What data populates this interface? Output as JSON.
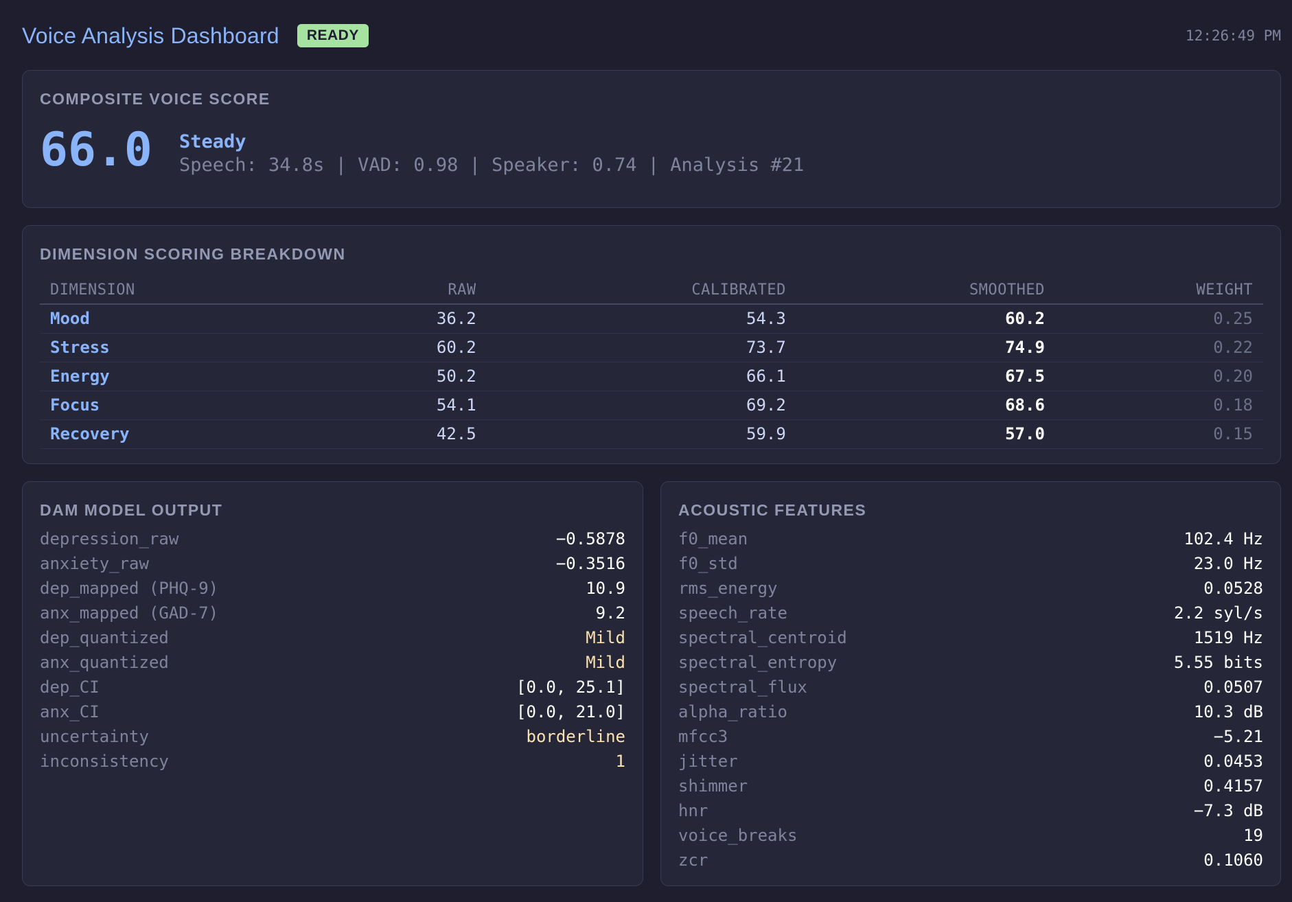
{
  "header": {
    "title": "Voice Analysis Dashboard",
    "status": "READY",
    "time": "12:26:49 PM"
  },
  "composite": {
    "title": "COMPOSITE VOICE SCORE",
    "score": "66.0",
    "state": "Steady",
    "meta": "Speech: 34.8s | VAD: 0.98 | Speaker: 0.74 | Analysis #21"
  },
  "dimensions": {
    "title": "DIMENSION SCORING BREAKDOWN",
    "columns": [
      "DIMENSION",
      "RAW",
      "CALIBRATED",
      "SMOOTHED",
      "WEIGHT"
    ],
    "rows": [
      {
        "name": "Mood",
        "raw": "36.2",
        "calibrated": "54.3",
        "smoothed": "60.2",
        "weight": "0.25"
      },
      {
        "name": "Stress",
        "raw": "60.2",
        "calibrated": "73.7",
        "smoothed": "74.9",
        "weight": "0.22"
      },
      {
        "name": "Energy",
        "raw": "50.2",
        "calibrated": "66.1",
        "smoothed": "67.5",
        "weight": "0.20"
      },
      {
        "name": "Focus",
        "raw": "54.1",
        "calibrated": "69.2",
        "smoothed": "68.6",
        "weight": "0.18"
      },
      {
        "name": "Recovery",
        "raw": "42.5",
        "calibrated": "59.9",
        "smoothed": "57.0",
        "weight": "0.15"
      }
    ]
  },
  "dam": {
    "title": "DAM MODEL OUTPUT",
    "rows": [
      {
        "key": "depression_raw",
        "value": "−0.5878"
      },
      {
        "key": "anxiety_raw",
        "value": "−0.3516"
      },
      {
        "key": "dep_mapped (PHQ-9)",
        "value": "10.9"
      },
      {
        "key": "anx_mapped (GAD-7)",
        "value": "9.2"
      },
      {
        "key": "dep_quantized",
        "value": "Mild",
        "highlight": "#f9e2af"
      },
      {
        "key": "anx_quantized",
        "value": "Mild",
        "highlight": "#f9e2af"
      },
      {
        "key": "dep_CI",
        "value": "[0.0, 25.1]"
      },
      {
        "key": "anx_CI",
        "value": "[0.0, 21.0]"
      },
      {
        "key": "uncertainty",
        "value": "borderline",
        "highlight": "#f9e2af"
      },
      {
        "key": "inconsistency",
        "value": "1",
        "highlight": "#f9e2af"
      }
    ]
  },
  "acoustic": {
    "title": "ACOUSTIC FEATURES",
    "rows": [
      {
        "key": "f0_mean",
        "value": "102.4 Hz"
      },
      {
        "key": "f0_std",
        "value": "23.0 Hz"
      },
      {
        "key": "rms_energy",
        "value": "0.0528"
      },
      {
        "key": "speech_rate",
        "value": "2.2 syl/s"
      },
      {
        "key": "spectral_centroid",
        "value": "1519 Hz"
      },
      {
        "key": "spectral_entropy",
        "value": "5.55 bits"
      },
      {
        "key": "spectral_flux",
        "value": "0.0507"
      },
      {
        "key": "alpha_ratio",
        "value": "10.3 dB"
      },
      {
        "key": "mfcc3",
        "value": "−5.21"
      },
      {
        "key": "jitter",
        "value": "0.0453"
      },
      {
        "key": "shimmer",
        "value": "0.4157"
      },
      {
        "key": "hnr",
        "value": "−7.3 dB"
      },
      {
        "key": "voice_breaks",
        "value": "19"
      },
      {
        "key": "zcr",
        "value": "0.1060"
      }
    ]
  }
}
